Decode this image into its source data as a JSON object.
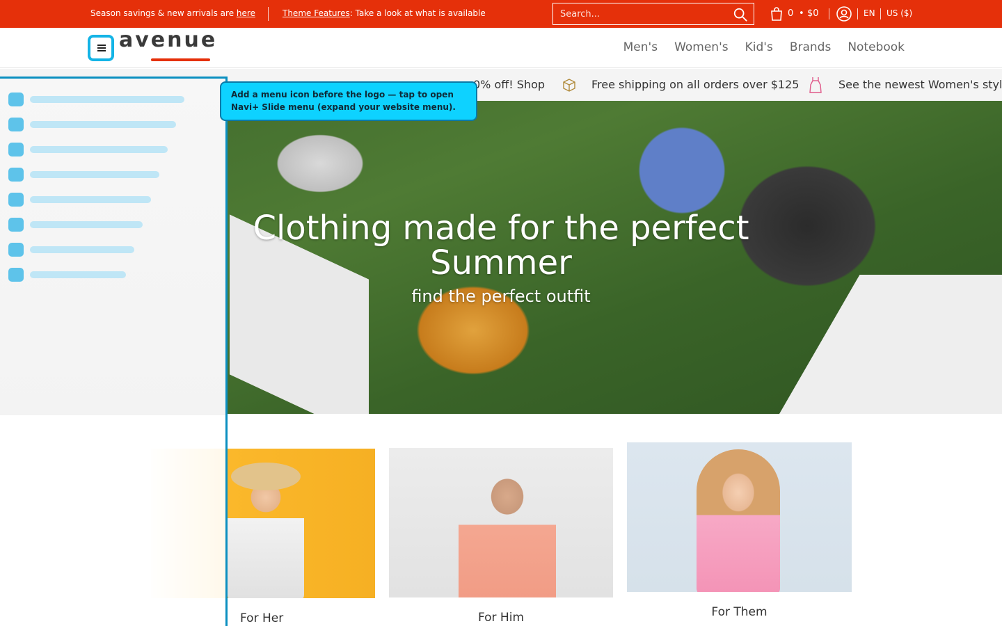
{
  "topbar": {
    "announcement_1_text": "Season savings & new arrivals are ",
    "announcement_1_link": "here",
    "announcement_2_link": "Theme Features",
    "announcement_2_text": ": Take a look at what is available",
    "search_placeholder": "Search...",
    "cart_count": "0",
    "cart_dot": "•",
    "cart_total": "$0",
    "language": "EN",
    "currency": "US ($)"
  },
  "header": {
    "logo_text": "avenue",
    "nav": [
      "Men's",
      "Women's",
      "Kid's",
      "Brands",
      "Notebook"
    ]
  },
  "promo": {
    "item_1": "0% off!  Shop",
    "item_2": "Free shipping on all orders over $125",
    "item_3": "See the newest Women's style"
  },
  "hero": {
    "title": "Clothing made for the perfect Summer",
    "subtitle": "find the perfect outfit"
  },
  "categories": [
    {
      "label": "For Her"
    },
    {
      "label": "For Him"
    },
    {
      "label": "For Them"
    }
  ],
  "tooltip": {
    "text": "Add a menu icon before the logo — tap to open Navi+ Slide menu (expand your website menu)."
  },
  "colors": {
    "brand_red": "#e5300a",
    "accent_blue": "#14b4e6",
    "tooltip_bg": "#0ed2ff"
  },
  "icons": {
    "search": "search-icon",
    "cart": "cart-icon",
    "account": "account-icon",
    "menu": "menu-icon",
    "box": "box-icon",
    "dress": "dress-icon"
  }
}
